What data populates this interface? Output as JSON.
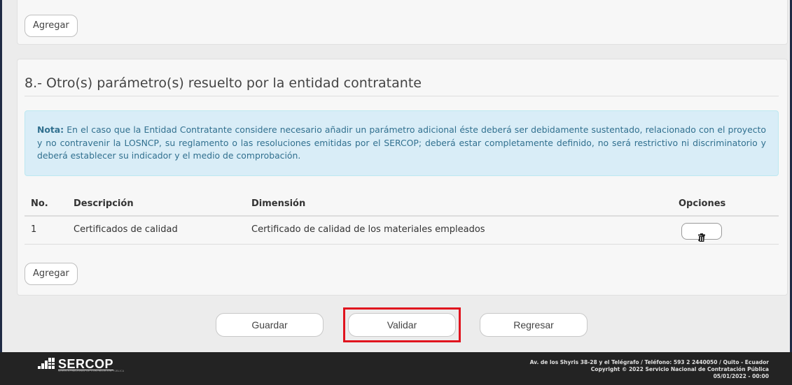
{
  "top_panel": {
    "add_label": "Agregar"
  },
  "section": {
    "title": "8.- Otro(s) parámetro(s) resuelto por la entidad contratante",
    "note_label": "Nota:",
    "note_text": " En el caso que la Entidad Contratante considere necesario añadir un parámetro adicional éste deberá ser debidamente sustentado, relacionado con el proyecto y no contravenir la LOSNCP, su reglamento o las resoluciones emitidas por el SERCOP; deberá estar completamente definido, no será restrictivo ni discriminatorio y deberá establecer su indicador y el medio de comprobación.",
    "table": {
      "headers": {
        "no": "No.",
        "desc": "Descripción",
        "dim": "Dimensión",
        "opt": "Opciones"
      },
      "rows": [
        {
          "no": "1",
          "desc": "Certificados de calidad",
          "dim": "Certificado de calidad de los materiales empleados"
        }
      ],
      "row_icons": [
        "pencil-icon",
        "trash-icon"
      ]
    },
    "add_label": "Agregar"
  },
  "actions": {
    "guardar": "Guardar",
    "validar": "Validar",
    "regresar": "Regresar",
    "highlight_color": "#e0141e"
  },
  "footer": {
    "logo_text": "SERCOP",
    "logo_subtitle": "SERVICIO NACIONAL DE CONTRATACIÓN PÚBLICA",
    "address": "Av. de los Shyris 38-28 y el Telégrafo / Teléfono: 593 2 2440050 / Quito - Ecuador",
    "copyright": "Copyright © 2022 Servicio Nacional de Contratación Pública",
    "datetime": "05/01/2022 - 00:00"
  },
  "colors": {
    "note_bg": "#d9edf7",
    "note_text": "#31708f",
    "footer_bg": "#232323"
  }
}
